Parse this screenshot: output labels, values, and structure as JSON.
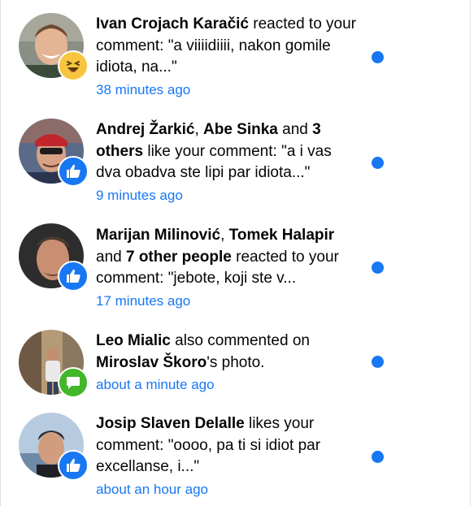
{
  "notifications": [
    {
      "actor1": "Ivan Crojach Karačić",
      "text1": " reacted to your comment: \"a viiiidiiii, nakon gomile idiota, na...\"",
      "time": "38 minutes ago",
      "badge": "haha-icon",
      "unread": true
    },
    {
      "actor1": "Andrej Žarkić",
      "sep1": ", ",
      "actor2": "Abe Sinka",
      "sep2": " and ",
      "actor3": "3 others",
      "text1": " like your comment: \"a i vas dva obadva ste lipi par idiota...\"",
      "time": "9 minutes ago",
      "badge": "like-icon",
      "unread": true
    },
    {
      "actor1": "Marijan Milinović",
      "sep1": ", ",
      "actor2": "Tomek Halapir",
      "sep2": " and ",
      "actor3": "7 other people",
      "text1": " reacted to your comment: \"jebote, koji ste v...",
      "time": "17 minutes ago",
      "badge": "like-icon",
      "unread": true
    },
    {
      "actor1": "Leo Mialic",
      "text1": " also commented on ",
      "actor2": "Miroslav Škoro",
      "text2": "'s photo.",
      "time": "about a minute ago",
      "badge": "comment-icon",
      "unread": true
    },
    {
      "actor1": "Josip Slaven Delalle",
      "text1": " likes your comment: \"oooo, pa ti si idiot par excellanse, i...\"",
      "time": "about an hour ago",
      "badge": "like-icon",
      "unread": true
    }
  ],
  "colors": {
    "accent": "#1877f2",
    "comment_badge": "#42b72a",
    "haha_badge": "#f7c63e",
    "text": "#050505"
  }
}
